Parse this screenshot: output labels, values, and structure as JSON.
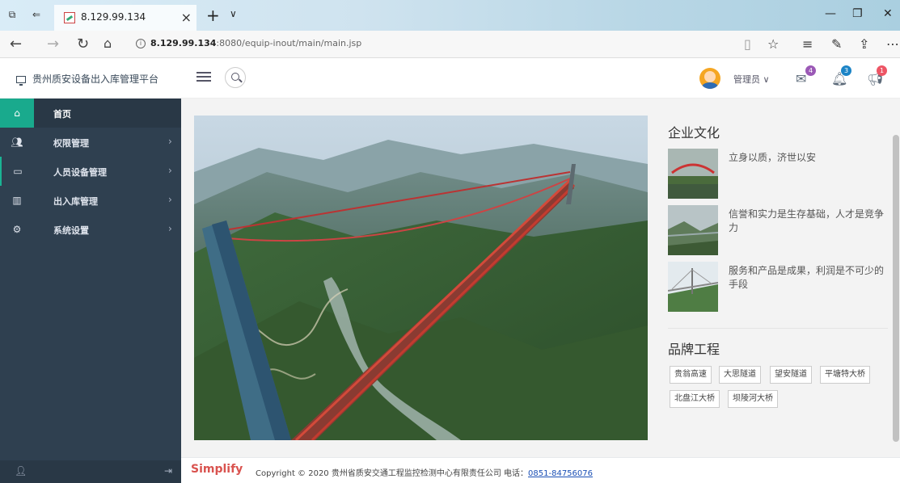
{
  "browser": {
    "tab_title": "8.129.99.134",
    "url_host": "8.129.99.134",
    "url_rest": ":8080/equip-inout/main/main.jsp"
  },
  "header": {
    "brand": "贵州质安设备出入库管理平台",
    "user": "管理员",
    "badges": {
      "messages": "4",
      "alerts": "3",
      "notices": "1"
    },
    "badge_colors": {
      "messages": "#9b59b6",
      "alerts": "#1c84c6",
      "notices": "#ed5565"
    }
  },
  "sidebar": {
    "items": [
      {
        "label": "首页",
        "icon": "home-icon",
        "has_arrow": false
      },
      {
        "label": "权限管理",
        "icon": "users-icon",
        "has_arrow": true
      },
      {
        "label": "人员设备管理",
        "icon": "card-icon",
        "has_arrow": true
      },
      {
        "label": "出入库管理",
        "icon": "chart-icon",
        "has_arrow": true
      },
      {
        "label": "系统设置",
        "icon": "gears-icon",
        "has_arrow": true
      }
    ]
  },
  "culture": {
    "title": "企业文化",
    "items": [
      {
        "text": "立身以质，济世以安"
      },
      {
        "text": "信誉和实力是生存基础，人才是竞争力"
      },
      {
        "text": "服务和产品是成果，利润是不可少的手段"
      }
    ]
  },
  "brands": {
    "title": "品牌工程",
    "tags": [
      "贵翁高速",
      "大思隧道",
      "望安隧道",
      "平塘特大桥",
      "北盘江大桥",
      "坝陵河大桥"
    ]
  },
  "footer": {
    "logo": "Simplify",
    "copyright": "Copyright © 2020 贵州省质安交通工程监控检测中心有限责任公司 电话：",
    "phone": "0851-84756076"
  },
  "colors": {
    "sidebar": "#2f4050",
    "active": "#19aa8d",
    "footer_logo": "#d9534f"
  }
}
